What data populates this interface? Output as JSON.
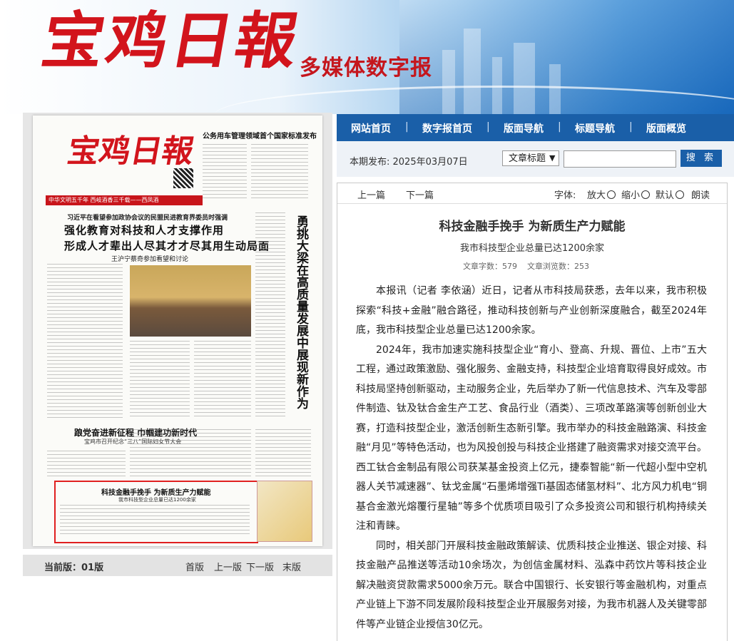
{
  "header": {
    "logo_text": "宝鸡日報",
    "subtitle": "多媒体数字报"
  },
  "nav": {
    "items": [
      "网站首页",
      "数字报首页",
      "版面导航",
      "标题导航",
      "版面概览"
    ],
    "separator": "|"
  },
  "search": {
    "publish_label": "本期发布:  2025年03月07日",
    "select_value": "文章标题",
    "input_value": "",
    "button_label": "搜 索"
  },
  "toolbar": {
    "prev": "上一篇",
    "next": "下一篇",
    "font_label": "字体:",
    "zoom_in": "放大",
    "zoom_out": "缩小",
    "default": "默认",
    "read": "朗读"
  },
  "article": {
    "title": "科技金融手挽手 为新质生产力赋能",
    "subtitle": "我市科技型企业总量已达1200余家",
    "word_count": "文章字数：579",
    "view_count": "文章浏览数：253",
    "paragraphs": [
      "本报讯（记者 李依涵）近日，记者从市科技局获悉，去年以来，我市积极探索“科技+金融”融合路径，推动科技创新与产业创新深度融合，截至2024年底，我市科技型企业总量已达1200余家。",
      "2024年，我市加速实施科技型企业“育小、登高、升规、晋位、上市”五大工程，通过政策激励、强化服务、金融支持，科技型企业培育取得良好成效。市科技局坚持创新驱动，主动服务企业，先后举办了新一代信息技术、汽车及零部件制造、钛及钛合金生产工艺、食品行业（酒类）、三项改革路演等创新创业大赛，打造科技型企业，激活创新生态新引擎。我市举办的科技金融路演、科技金融“月见”等特色活动，也为风投创投与科技企业搭建了融资需求对接交流平台。西工钛合金制品有限公司获某基金投资上亿元，捷泰智能“新一代超小型中空机器人关节减速器”、钛戈金属“石墨烯增强Ti基固态储氢材料”、北方风力机电“铜基合金激光熔覆行星轴”等多个优质项目吸引了众多投资公司和银行机构持续关注和青睐。",
      "同时，相关部门开展科技金融政策解读、优质科技企业推送、银企对接、科技金融产品推送等活动10余场次，为创信金属材料、泓森中药饮片等科技企业解决融资贷款需求5000余万元。联合中国银行、长安银行等金融机构，对重点产业链上下游不同发展阶段科技型企业开展服务对接，为我市机器人及关键零部件等产业链企业授信30亿元。"
    ]
  },
  "edition": {
    "current_label": "当前版：01版",
    "first": "首版",
    "prev": "上一版",
    "next": "下一版",
    "last": "末版"
  },
  "paper_page": {
    "masthead": "宝鸡日報",
    "red_bar": "中华文明五千年  西岐酒香三千载——西凤酒",
    "top_right_headline": "公务用车管理领域首个国家标准发布",
    "lead_kicker": "习近平在看望参加政协会议的民盟民进教育界委员时强调",
    "lead_line1": "强化教育对科技和人才支撑作用",
    "lead_line2": "形成人才辈出人尽其才才尽其用生动局面",
    "lead_sub": "王沪宁蔡奇参加看望和讨论",
    "vertical_title": "勇挑大梁在高质量发展中展现新作为",
    "second_headline": "踉党奋进新征程 巾帼建功新时代",
    "second_sub": "宝鸡市召开纪念“三八”国际妇女节大会",
    "highlight_title": "科技金融手挽手  为新质生产力赋能",
    "highlight_sub": "我市科技型企业总量已达1200余家"
  }
}
